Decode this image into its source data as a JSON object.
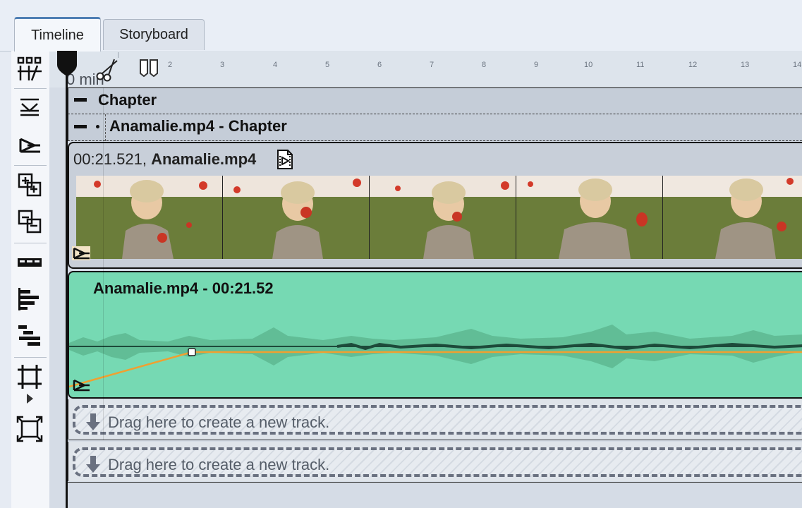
{
  "tabs": [
    {
      "label": "Timeline",
      "active": true
    },
    {
      "label": "Storyboard",
      "active": false
    }
  ],
  "toolbar": {
    "icons": [
      "split-tracks-icon",
      "collapse-icon",
      "expand-icon",
      "zoom-in-icon",
      "zoom-out-icon",
      "segments-icon",
      "align-left-icon",
      "align-stack-icon",
      "fit-frame-icon",
      "fit-all-icon"
    ]
  },
  "ruler": {
    "ticks": [
      "2",
      "3",
      "4",
      "5",
      "6",
      "7",
      "8",
      "9",
      "10",
      "11",
      "12",
      "13",
      "14"
    ],
    "current_time": "0 min"
  },
  "chapter": {
    "title": "Chapter"
  },
  "sub_chapter": {
    "title": "Anamalie.mp4 - Chapter"
  },
  "video_track": {
    "duration": "00:21.521,",
    "filename": "Anamalie.mp4"
  },
  "audio_track": {
    "title": "Anamalie.mp4 - 00:21.52"
  },
  "drop_zones": [
    {
      "label": "Drag here to create a new track."
    },
    {
      "label": "Drag here to create a new track."
    }
  ],
  "colors": {
    "audio_bg": "#76d9b3",
    "volume_line": "#f0a030",
    "tab_accent": "#4f7fb4"
  }
}
